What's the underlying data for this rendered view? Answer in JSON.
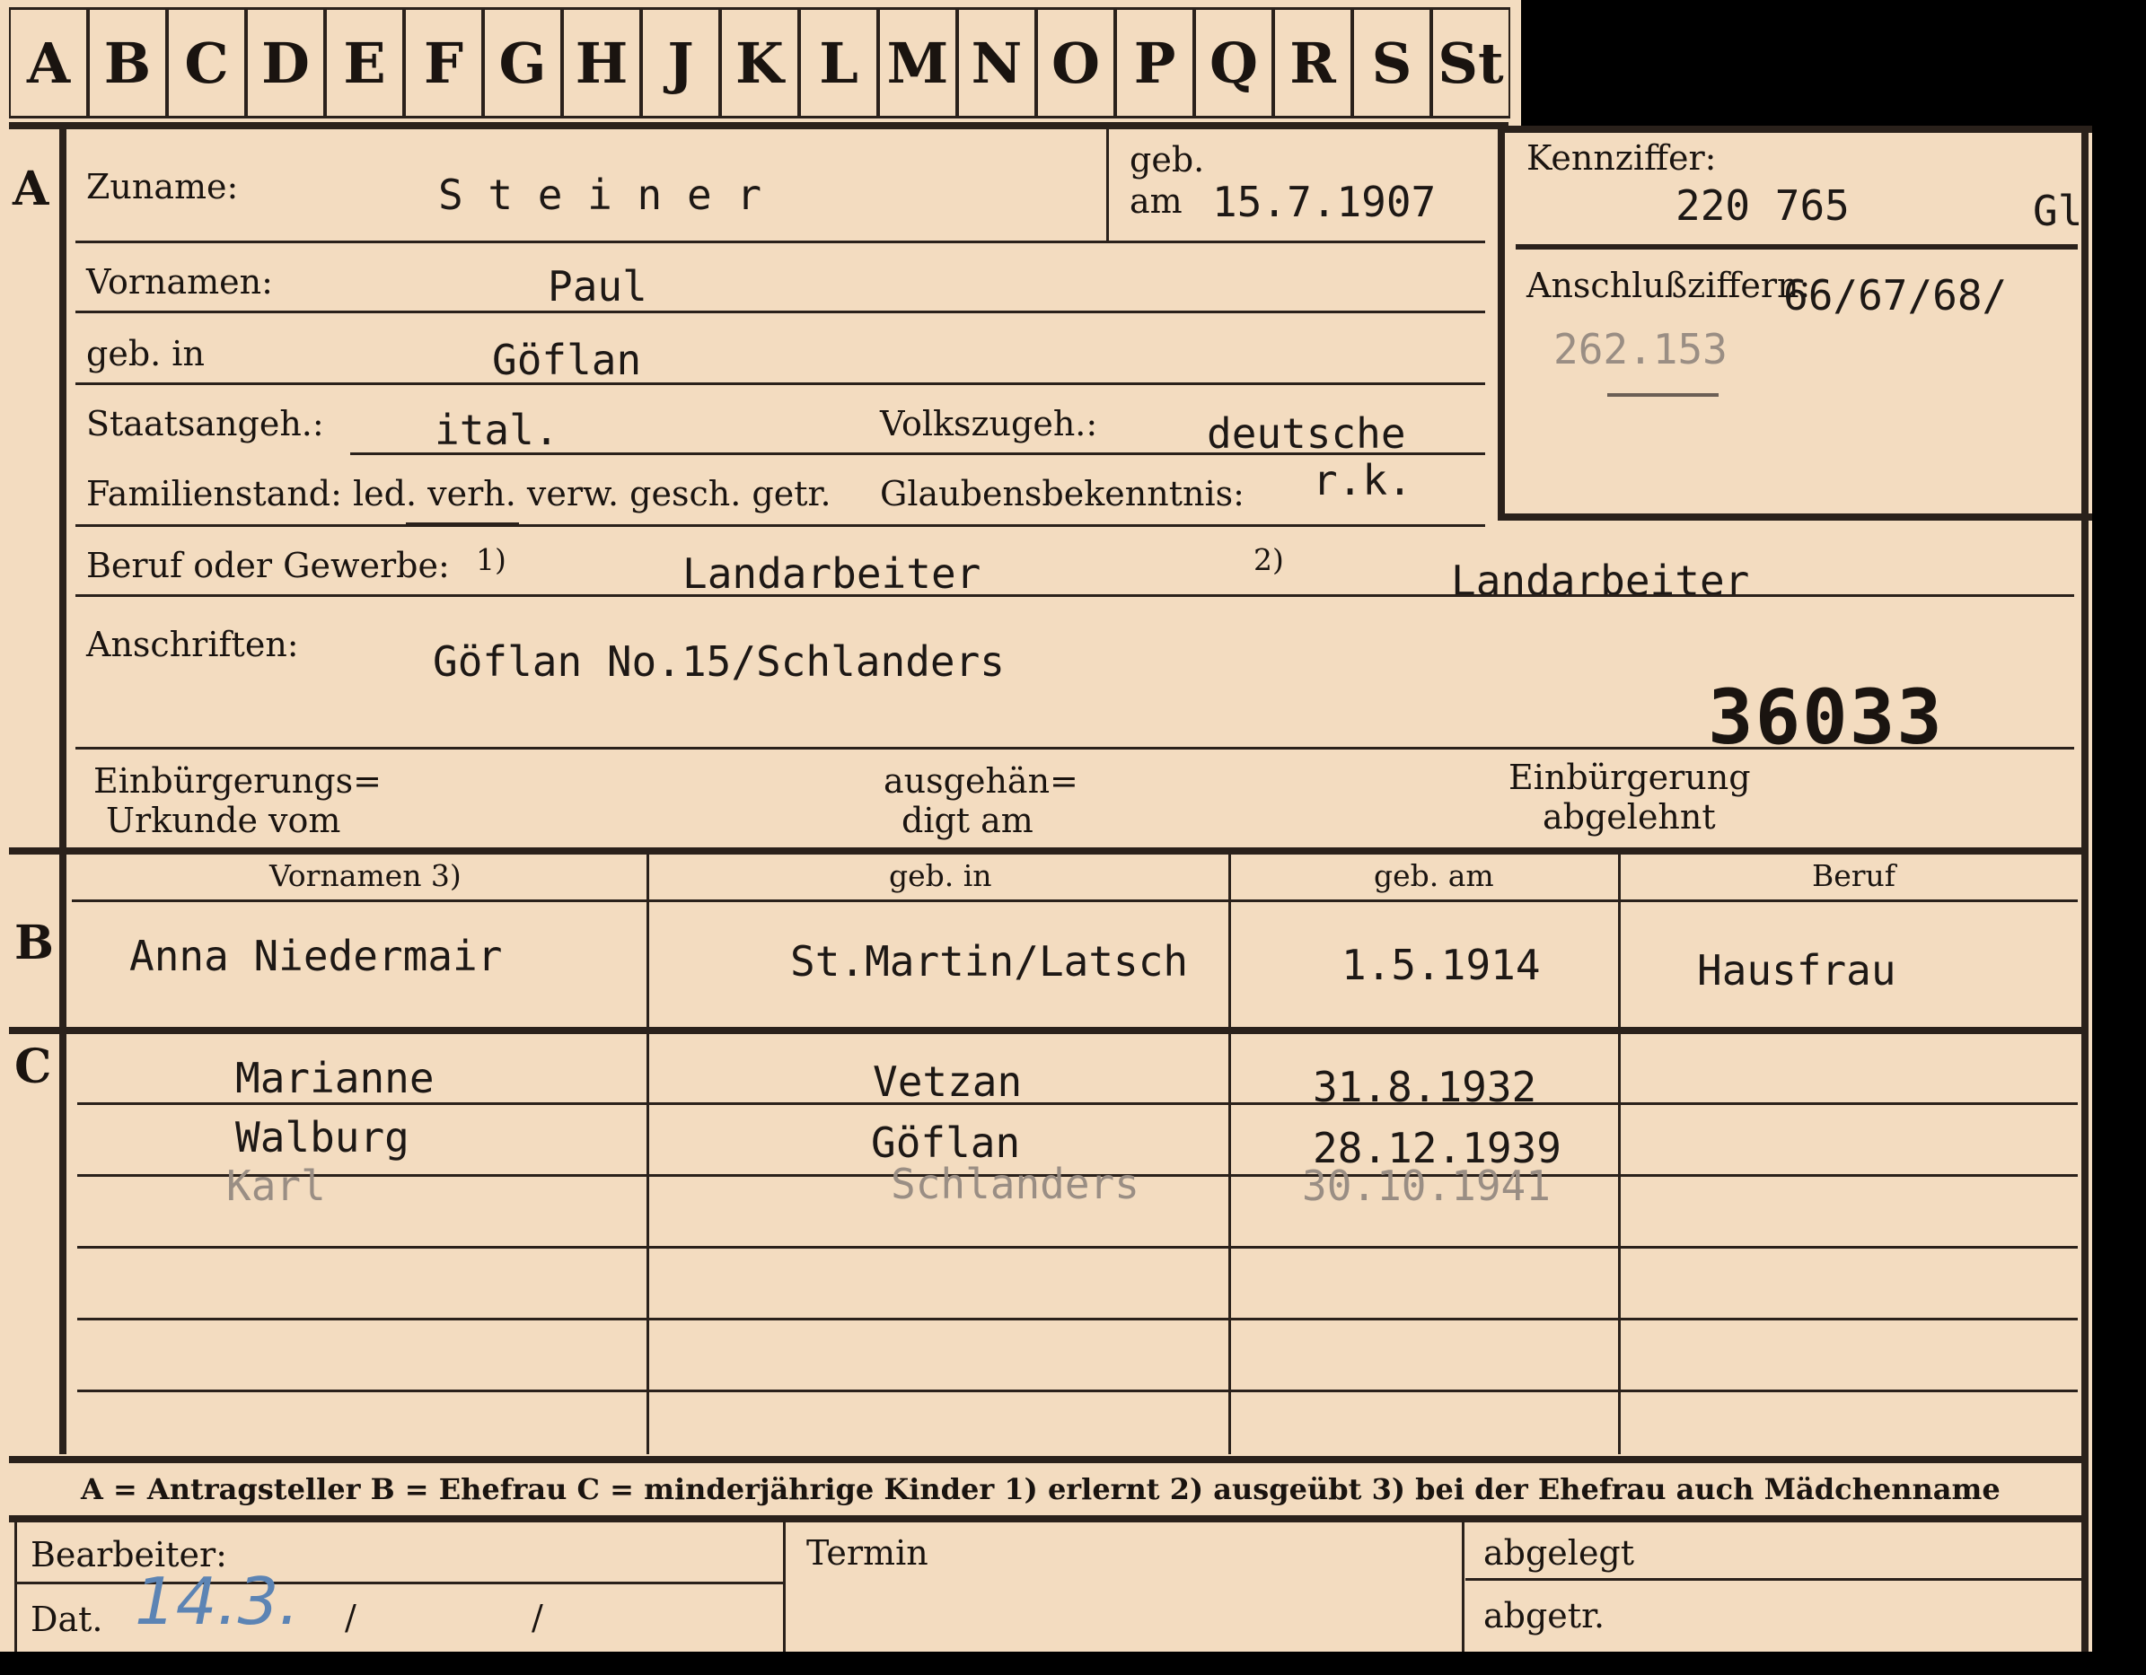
{
  "tabs": [
    "A",
    "B",
    "C",
    "D",
    "E",
    "F",
    "G",
    "H",
    "J",
    "K",
    "L",
    "M",
    "N",
    "O",
    "P",
    "Q",
    "R",
    "S",
    "St"
  ],
  "sections": {
    "a": "A",
    "b": "B",
    "c": "C"
  },
  "labels": {
    "zuname": "Zuname:",
    "geb_top": "geb.",
    "am": "am",
    "vornamen": "Vornamen:",
    "geb_in": "geb. in",
    "staatsangeh": "Staatsangeh.:",
    "volkszugeh": "Volkszugeh.:",
    "familienstand": "Familienstand: led. verh. verw. gesch. getr.",
    "glaubensbekenntnis": "Glaubensbekenntnis:",
    "beruf": "Beruf oder Gewerbe:",
    "sup1": "1)",
    "sup2": "2)",
    "anschriften": "Anschriften:",
    "einb1": "Einbürgerungs=",
    "einb2": "Urkunde vom",
    "ausg1": "ausgehän=",
    "ausg2": "digt am",
    "abg1": "Einbürgerung",
    "abg2": "abgelehnt",
    "kennziffer": "Kennziffer:",
    "anschlussziffern": "Anschlußziffern:",
    "col_vornamen": "Vornamen 3)",
    "col_gebin": "geb. in",
    "col_gebam": "geb. am",
    "col_beruf": "Beruf",
    "legend": "A = Antragsteller   B = Ehefrau   C = minderjährige Kinder   1) erlernt   2) ausgeübt   3) bei der Ehefrau auch Mädchenname",
    "bearbeiter": "Bearbeiter:",
    "dat": "Dat.",
    "termin": "Termin",
    "abgelegt": "abgelegt",
    "abgetr": "abgetr."
  },
  "values": {
    "zuname": "S t e i n e r",
    "geb_am": "15.7.1907",
    "vornamen": "Paul",
    "geb_in": "Göflan",
    "staatsangeh": "ital.",
    "volkszugeh": "deutsche",
    "glaube": "r.k.",
    "beruf1": "Landarbeiter",
    "beruf2": "Landarbeiter",
    "anschrift": "Göflan No.15/Schlanders",
    "stamp_number": "36033",
    "kennziffer": "220 765",
    "kennziffer_suffix": "Gl",
    "anschluss1": "66/67/68/",
    "anschluss2": "262.153",
    "date_pencil": "14.3.",
    "dat_sep1": "/",
    "dat_sep2": "/"
  },
  "ehefrau": {
    "name": "Anna Niedermair",
    "gebin": "St.Martin/Latsch",
    "gebam": "1.5.1914",
    "beruf": "Hausfrau"
  },
  "kinder": [
    {
      "name": "Marianne",
      "gebin": "Vetzan",
      "gebam": "31.8.1932"
    },
    {
      "name": "Walburg",
      "gebin": "Göflan",
      "gebam": "28.12.1939"
    },
    {
      "name": "Karl",
      "gebin": "Schlanders",
      "gebam": "30.10.1941"
    }
  ]
}
